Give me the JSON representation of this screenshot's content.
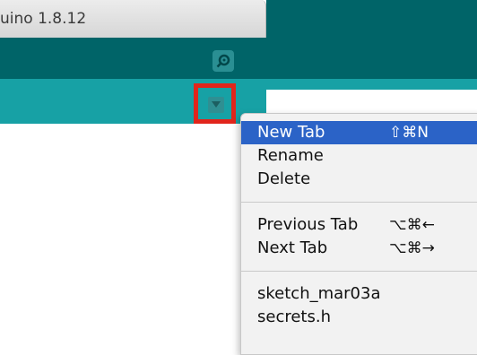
{
  "window": {
    "title": "uino 1.8.12"
  },
  "toolbar": {
    "serial_monitor_icon": "magnifier-icon"
  },
  "tabbar": {
    "menu_button_icon": "triangle-down-icon",
    "highlight_color": "#e1251b"
  },
  "colors": {
    "toolbar": "#006468",
    "tabbar": "#17a1a5",
    "menu_highlight": "#2b63c7"
  },
  "menu": {
    "new_tab": {
      "label": "New Tab",
      "shortcut": "⇧⌘N"
    },
    "rename": {
      "label": "Rename"
    },
    "delete": {
      "label": "Delete"
    },
    "previous_tab": {
      "label": "Previous Tab",
      "shortcut": "⌥⌘←"
    },
    "next_tab": {
      "label": "Next Tab",
      "shortcut": "⌥⌘→"
    },
    "sketches": [
      "sketch_mar03a",
      "secrets.h"
    ]
  }
}
